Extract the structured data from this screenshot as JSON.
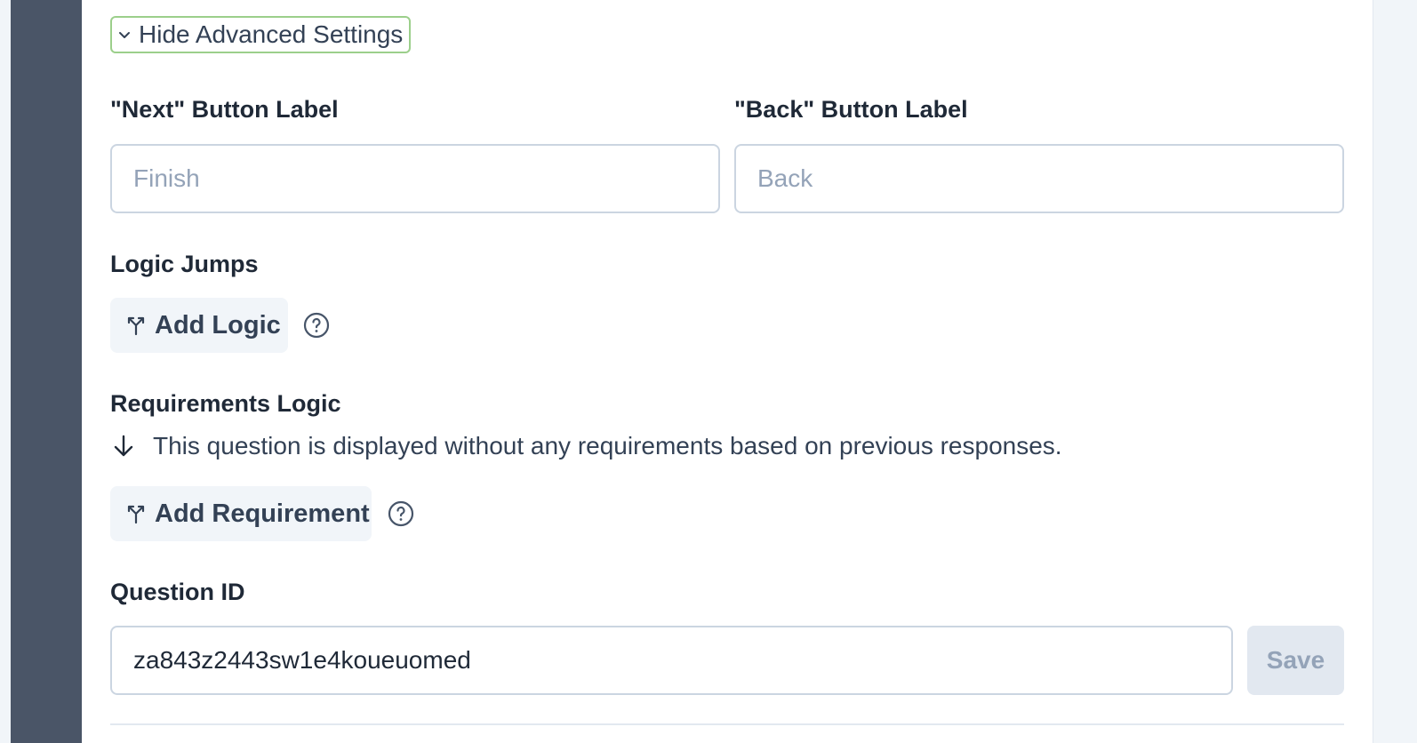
{
  "advanced_toggle": {
    "label": "Hide Advanced Settings",
    "icon": "chevron-down-icon"
  },
  "button_labels": {
    "next_label": "\"Next\" Button Label",
    "next_placeholder": "Finish",
    "next_value": "",
    "back_label": "\"Back\" Button Label",
    "back_placeholder": "Back",
    "back_value": ""
  },
  "logic_jumps": {
    "heading": "Logic Jumps",
    "add_button": "Add Logic",
    "icon": "split-icon",
    "help_icon": "help-circle-icon"
  },
  "requirements": {
    "heading": "Requirements Logic",
    "message": "This question is displayed without any requirements based on previous responses.",
    "message_icon": "arrow-down-icon",
    "add_button": "Add Requirement",
    "icon": "split-icon",
    "help_icon": "help-circle-icon"
  },
  "question_id": {
    "heading": "Question ID",
    "value": "za843z2443sw1e4koueuomed",
    "save_button": "Save"
  },
  "colors": {
    "sidebar": "#4a5567",
    "focus_ring": "#9ccf8b",
    "chip_bg": "#f1f5f9",
    "border": "#cbd5e1",
    "placeholder": "#94a3b8"
  }
}
